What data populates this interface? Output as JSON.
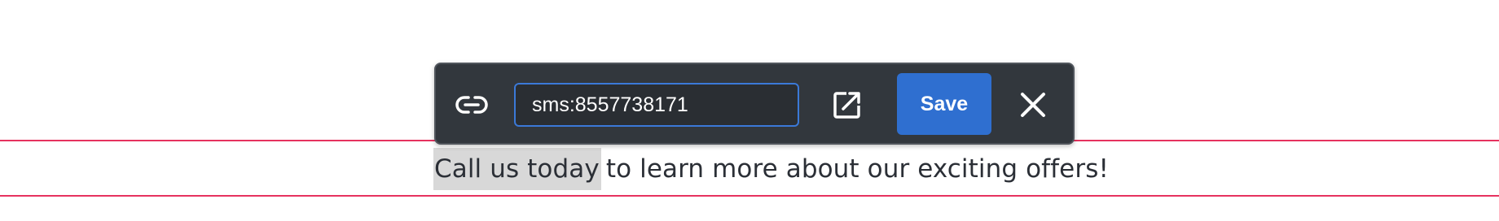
{
  "link_editor": {
    "url_value": "sms:8557738171",
    "save_label": "Save",
    "icons": {
      "link": "link-icon",
      "open": "open-in-new-icon",
      "close": "close-icon"
    },
    "colors": {
      "toolbar_bg": "#32373d",
      "input_border": "#3b79d8",
      "save_bg": "#2f6fd0"
    }
  },
  "content": {
    "linked_text": "Call us today",
    "rest_text": "to learn more about our exciting offers!"
  },
  "colors": {
    "guide_line": "#e6325f",
    "selection_bg": "#d8d8d8"
  }
}
